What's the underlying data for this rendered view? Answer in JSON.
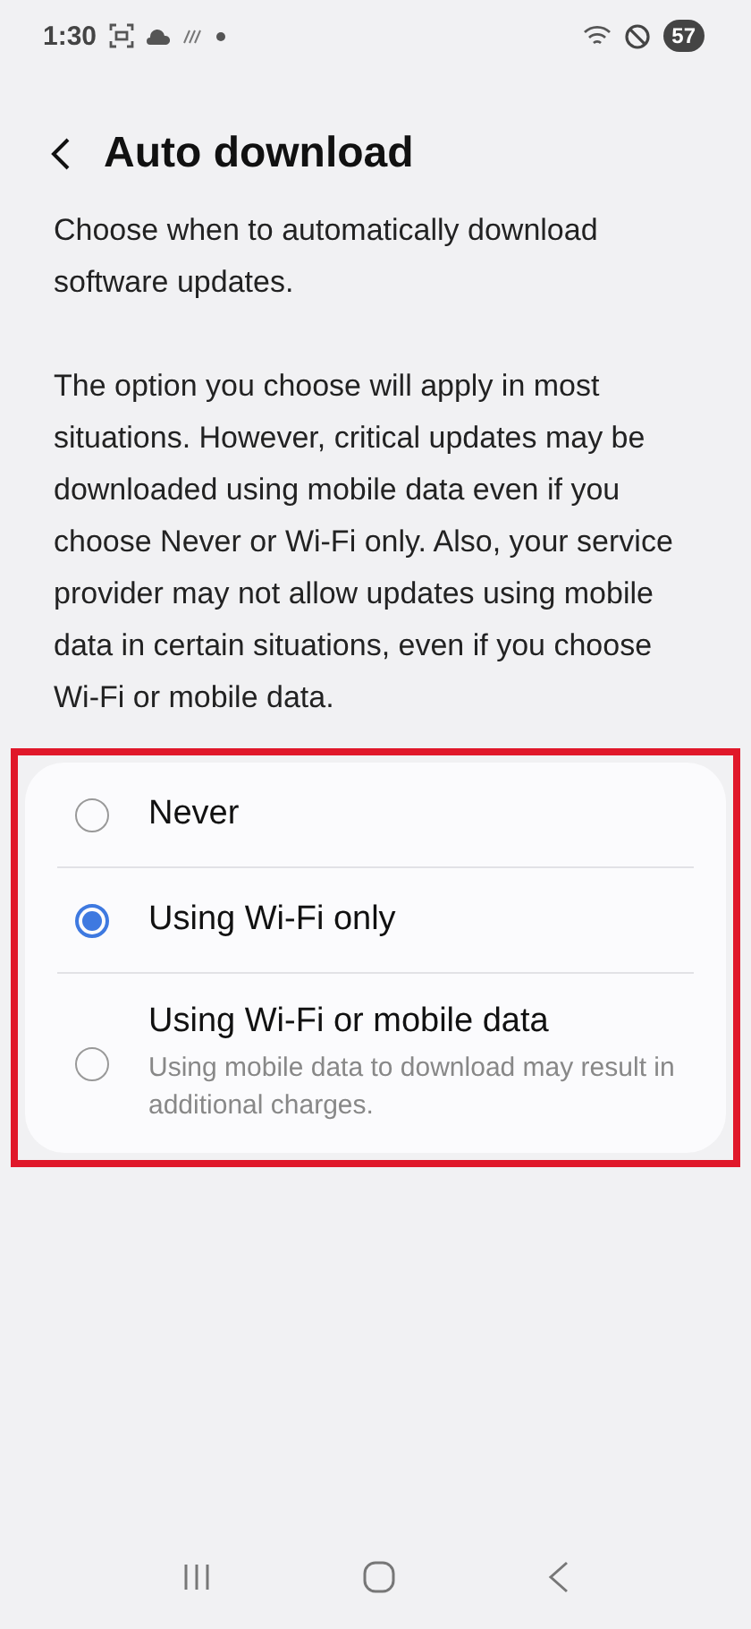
{
  "status_bar": {
    "time": "1:30",
    "battery": "57"
  },
  "header": {
    "title": "Auto download"
  },
  "description": [
    "Choose when to automatically download software updates.",
    "The option you choose will apply in most situations. However, critical updates may be downloaded using mobile data even if you choose Never or Wi-Fi only. Also, your service provider may not allow updates using mobile data in certain situations, even if you choose Wi-Fi or mobile data."
  ],
  "options_card": {
    "highlighted": true,
    "options": [
      {
        "label": "Never",
        "selected": false
      },
      {
        "label": "Using Wi-Fi only",
        "selected": true
      },
      {
        "label": "Using Wi-Fi or mobile data",
        "subtitle": "Using mobile data to download may result in additional charges.",
        "selected": false
      }
    ]
  }
}
